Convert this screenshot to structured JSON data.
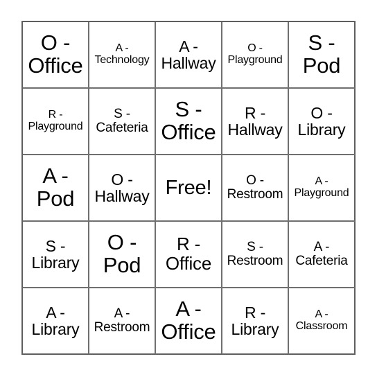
{
  "card": {
    "type": "bingo-card",
    "columns": 5,
    "rows": 5,
    "background_color": "#ffffff",
    "text_color": "#000000",
    "grid_line_color": "#6f6f6f",
    "outer_border_color": "#5e5e5e",
    "free_space_label": "Free!",
    "free_space_index": 12,
    "cells": [
      {
        "text": "O -\nOffice",
        "size": "xl"
      },
      {
        "text": "A -\nTechnology",
        "size": "xs"
      },
      {
        "text": "A -\nHallway",
        "size": "md"
      },
      {
        "text": "O -\nPlayground",
        "size": "xs"
      },
      {
        "text": "S -\nPod",
        "size": "xl"
      },
      {
        "text": "R -\nPlayground",
        "size": "xs"
      },
      {
        "text": "S -\nCafeteria",
        "size": "sm"
      },
      {
        "text": "S -\nOffice",
        "size": "xl"
      },
      {
        "text": "R -\nHallway",
        "size": "md"
      },
      {
        "text": "O -\nLibrary",
        "size": "md"
      },
      {
        "text": "A -\nPod",
        "size": "xl"
      },
      {
        "text": "O -\nHallway",
        "size": "md"
      },
      {
        "text": "Free!",
        "size": "free"
      },
      {
        "text": "O -\nRestroom",
        "size": "sm"
      },
      {
        "text": "A -\nPlayground",
        "size": "xs"
      },
      {
        "text": "S -\nLibrary",
        "size": "md"
      },
      {
        "text": "O -\nPod",
        "size": "xl"
      },
      {
        "text": "R -\nOffice",
        "size": "lg"
      },
      {
        "text": "S -\nRestroom",
        "size": "sm"
      },
      {
        "text": "A -\nCafeteria",
        "size": "sm"
      },
      {
        "text": "A -\nLibrary",
        "size": "md"
      },
      {
        "text": "A -\nRestroom",
        "size": "sm"
      },
      {
        "text": "A -\nOffice",
        "size": "xl"
      },
      {
        "text": "R -\nLibrary",
        "size": "md"
      },
      {
        "text": "A -\nClassroom",
        "size": "xs"
      }
    ]
  }
}
